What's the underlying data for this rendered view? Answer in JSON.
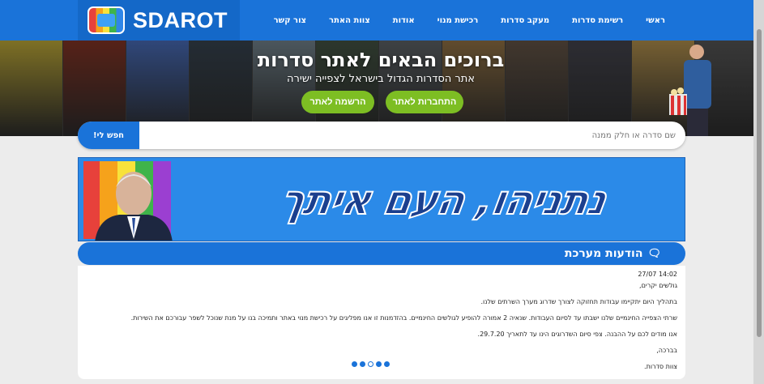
{
  "logo": {
    "text": "SDAROT"
  },
  "nav": {
    "items": [
      "ראשי",
      "רשימת סדרות",
      "מעקב סדרות",
      "רכישת מנוי",
      "אודות",
      "צוות האתר",
      "צור קשר"
    ]
  },
  "hero": {
    "title": "ברוכים הבאים לאתר סדרות",
    "subtitle": "אתר הסדרות הגדול בישראל לצפייה ישירה",
    "login_label": "התחברות לאתר",
    "register_label": "הרשמה לאתר",
    "poster_colors": [
      "#b7a22f",
      "#7a2a1b",
      "#3f63b0",
      "#2d3a46",
      "#6a7a84",
      "#3a4a3a",
      "#555a5e",
      "#8a6a3c",
      "#5b4b3d",
      "#3b3b44",
      "#aa8844",
      "#4d4d4d"
    ]
  },
  "search": {
    "placeholder": "שם סדרה או חלק ממנה",
    "button_label": "חפש לי!"
  },
  "banner": {
    "text": "נתניהו, העם איתך"
  },
  "messages": {
    "title": "הודעות מערכת",
    "lines": [
      "14:02 27/07",
      "גולשים יקרים,",
      "בתהליך היום יתקיימו עבודות תחזוקה לצורך שדרוג מערך השרתים שלנו.",
      "שרתי הצפייה החינמיים שלנו ישבתו עד לסיום העבודות. שנאיה 2 אמורה להופיע לגולשים החינמיים. בהזדמנות זו אנו מפליגים על רכישת מנוי באתר ותמיכה בנו על מנת שנוכל לשפר עבורכם את השירות.",
      "אנו מודים לכם על ההבנה. צפי סיום השדרוגים הינו עד לתאריך 29.7.20.",
      "בברכה,",
      "צוות סדרות."
    ],
    "dots_active_index": 2
  },
  "colors": {
    "brand_blue": "#1a73d9",
    "green": "#7dbe23",
    "background": "#ececec"
  }
}
